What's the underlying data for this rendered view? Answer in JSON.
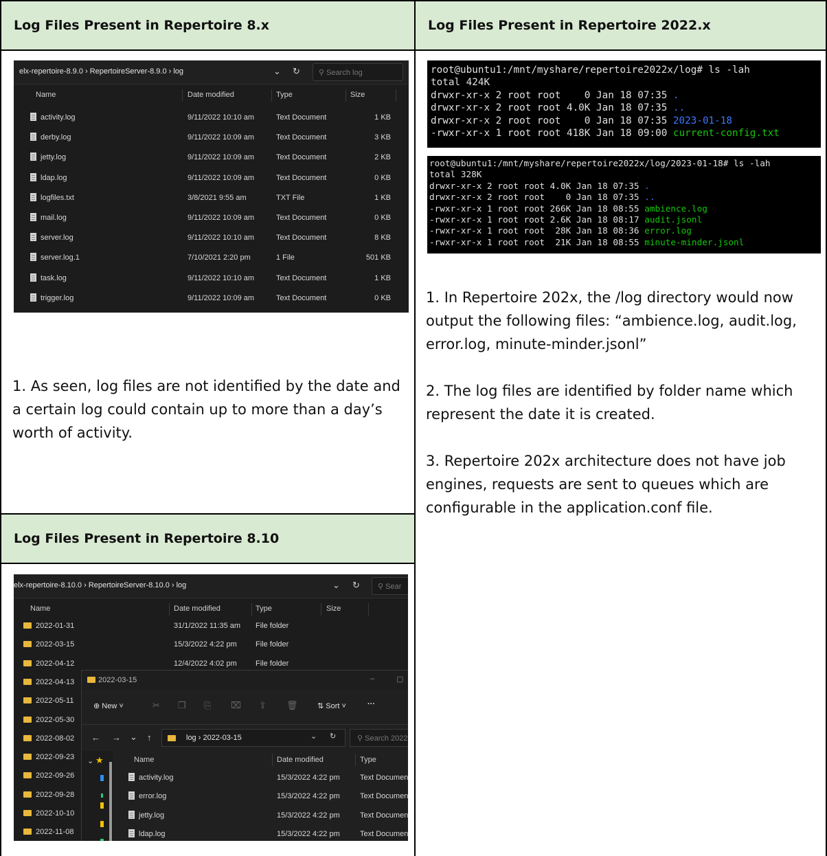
{
  "headers": {
    "h8x": "Log Files Present in Repertoire 8.x",
    "h2022": "Log Files Present in Repertoire 2022.x",
    "h810": "Log Files Present in Repertoire 8.10"
  },
  "explorer_8x": {
    "breadcrumb": "elx-repertoire-8.9.0 › RepertoireServer-8.9.0 › log",
    "search_placeholder": "Search log",
    "columns": {
      "name": "Name",
      "date": "Date modified",
      "type": "Type",
      "size": "Size"
    },
    "rows": [
      {
        "name": "activity.log",
        "date": "9/11/2022 10:10 am",
        "type": "Text Document",
        "size": "1 KB"
      },
      {
        "name": "derby.log",
        "date": "9/11/2022 10:09 am",
        "type": "Text Document",
        "size": "3 KB"
      },
      {
        "name": "jetty.log",
        "date": "9/11/2022 10:09 am",
        "type": "Text Document",
        "size": "2 KB"
      },
      {
        "name": "ldap.log",
        "date": "9/11/2022 10:09 am",
        "type": "Text Document",
        "size": "0 KB"
      },
      {
        "name": "logfiles.txt",
        "date": "3/8/2021 9:55 am",
        "type": "TXT File",
        "size": "1 KB"
      },
      {
        "name": "mail.log",
        "date": "9/11/2022 10:09 am",
        "type": "Text Document",
        "size": "0 KB"
      },
      {
        "name": "server.log",
        "date": "9/11/2022 10:10 am",
        "type": "Text Document",
        "size": "8 KB"
      },
      {
        "name": "server.log.1",
        "date": "7/10/2021 2:20 pm",
        "type": "1 File",
        "size": "501 KB"
      },
      {
        "name": "task.log",
        "date": "9/11/2022 10:10 am",
        "type": "Text Document",
        "size": "1 KB"
      },
      {
        "name": "trigger.log",
        "date": "9/11/2022 10:09 am",
        "type": "Text Document",
        "size": "0 KB"
      }
    ]
  },
  "note_8x": "1. As seen, log files are not identified by the date and a certain log could contain up to more than a day’s worth of activity.",
  "terminal_1": {
    "prompt": "root@ubuntu1:/mnt/myshare/repertoire2022x/log# ls -lah",
    "total": "total 424K",
    "lines": [
      {
        "meta": "drwxr-xr-x 2 root root    0 Jan 18 07:35 ",
        "name": ".",
        "color": "blue"
      },
      {
        "meta": "drwxr-xr-x 2 root root 4.0K Jan 18 07:35 ",
        "name": "..",
        "color": "blue"
      },
      {
        "meta": "drwxr-xr-x 2 root root    0 Jan 18 07:35 ",
        "name": "2023-01-18",
        "color": "blue"
      },
      {
        "meta": "-rwxr-xr-x 1 root root 418K Jan 18 09:00 ",
        "name": "current-config.txt",
        "color": "green"
      }
    ]
  },
  "terminal_2": {
    "prompt": "root@ubuntu1:/mnt/myshare/repertoire2022x/log/2023-01-18# ls -lah",
    "total": "total 328K",
    "lines": [
      {
        "meta": "drwxr-xr-x 2 root root 4.0K Jan 18 07:35 ",
        "name": ".",
        "color": "blue"
      },
      {
        "meta": "drwxr-xr-x 2 root root    0 Jan 18 07:35 ",
        "name": "..",
        "color": "blue"
      },
      {
        "meta": "-rwxr-xr-x 1 root root 266K Jan 18 08:55 ",
        "name": "ambience.log",
        "color": "green"
      },
      {
        "meta": "-rwxr-xr-x 1 root root 2.6K Jan 18 08:17 ",
        "name": "audit.jsonl",
        "color": "green"
      },
      {
        "meta": "-rwxr-xr-x 1 root root  28K Jan 18 08:36 ",
        "name": "error.log",
        "color": "green"
      },
      {
        "meta": "-rwxr-xr-x 1 root root  21K Jan 18 08:55 ",
        "name": "minute-minder.jsonl",
        "color": "green"
      }
    ]
  },
  "notes_2022": [
    "1. In Repertoire 202x, the /log directory would now output the following files: “ambience.log, audit.log, error.log, minute-minder.jsonl”",
    "2. The log files are identified by folder name which represent the date it is created.",
    "3. Repertoire 202x architecture does not have job engines, requests are sent to queues which are configurable in the application.conf file."
  ],
  "explorer_810": {
    "breadcrumb": "elx-repertoire-8.10.0 › RepertoireServer-8.10.0 › log",
    "search_placeholder": "Sear",
    "columns": {
      "name": "Name",
      "date": "Date modified",
      "type": "Type",
      "size": "Size"
    },
    "folders": [
      {
        "name": "2022-01-31",
        "date": "31/1/2022 11:35 am",
        "type": "File folder"
      },
      {
        "name": "2022-03-15",
        "date": "15/3/2022 4:22 pm",
        "type": "File folder"
      },
      {
        "name": "2022-04-12",
        "date": "12/4/2022 4:02 pm",
        "type": "File folder"
      },
      {
        "name": "2022-04-13"
      },
      {
        "name": "2022-05-11"
      },
      {
        "name": "2022-05-30"
      },
      {
        "name": "2022-08-02"
      },
      {
        "name": "2022-09-23"
      },
      {
        "name": "2022-09-26"
      },
      {
        "name": "2022-09-28"
      },
      {
        "name": "2022-10-10"
      },
      {
        "name": "2022-11-08"
      }
    ],
    "overlay": {
      "title": "2022-03-15",
      "new_label": "New",
      "sort_label": "Sort",
      "more_label": "···",
      "breadcrumb": "log › 2022-03-15",
      "search_placeholder": "Search 2022",
      "columns": {
        "name": "Name",
        "date": "Date modified",
        "type": "Type"
      },
      "rows": [
        {
          "name": "activity.log",
          "date": "15/3/2022 4:22 pm",
          "type": "Text Document"
        },
        {
          "name": "error.log",
          "date": "15/3/2022 4:22 pm",
          "type": "Text Document"
        },
        {
          "name": "jetty.log",
          "date": "15/3/2022 4:22 pm",
          "type": "Text Document"
        },
        {
          "name": "ldap.log",
          "date": "15/3/2022 4:22 pm",
          "type": "Text Document"
        }
      ]
    }
  },
  "colors": {
    "header_bg": "#d9ead3",
    "terminal_blue": "#3b78ff",
    "terminal_green": "#16c60c"
  }
}
